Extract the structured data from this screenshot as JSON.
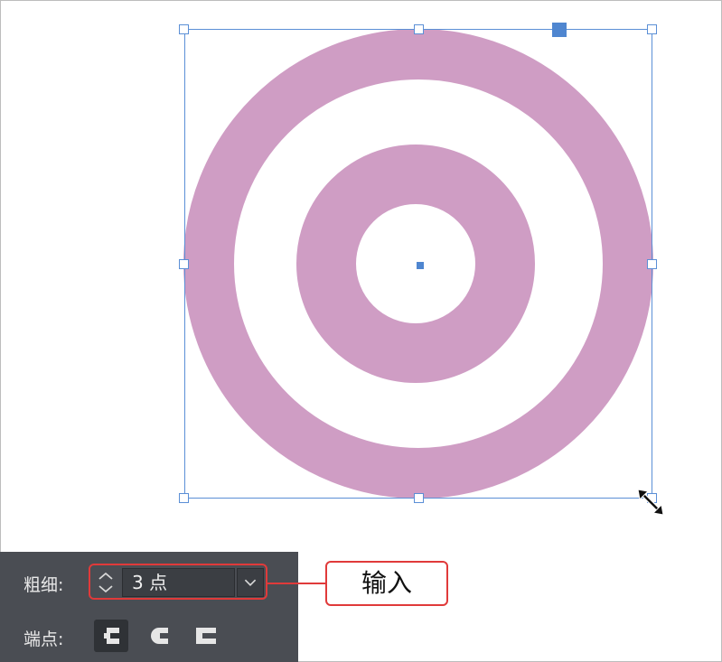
{
  "canvas": {
    "shape": "concentric-rings",
    "fill_color": "#cf9dc4",
    "selection_color": "#5b8fd6"
  },
  "stroke_panel": {
    "weight_label": "粗细:",
    "weight_value": "3 点",
    "cap_label": "端点:",
    "cap_options": [
      {
        "name": "butt-cap-icon",
        "active": true
      },
      {
        "name": "round-cap-icon",
        "active": false
      },
      {
        "name": "projecting-cap-icon",
        "active": false
      }
    ]
  },
  "annotation": {
    "callout_text": "输入",
    "highlight_color": "#e03a3a"
  }
}
